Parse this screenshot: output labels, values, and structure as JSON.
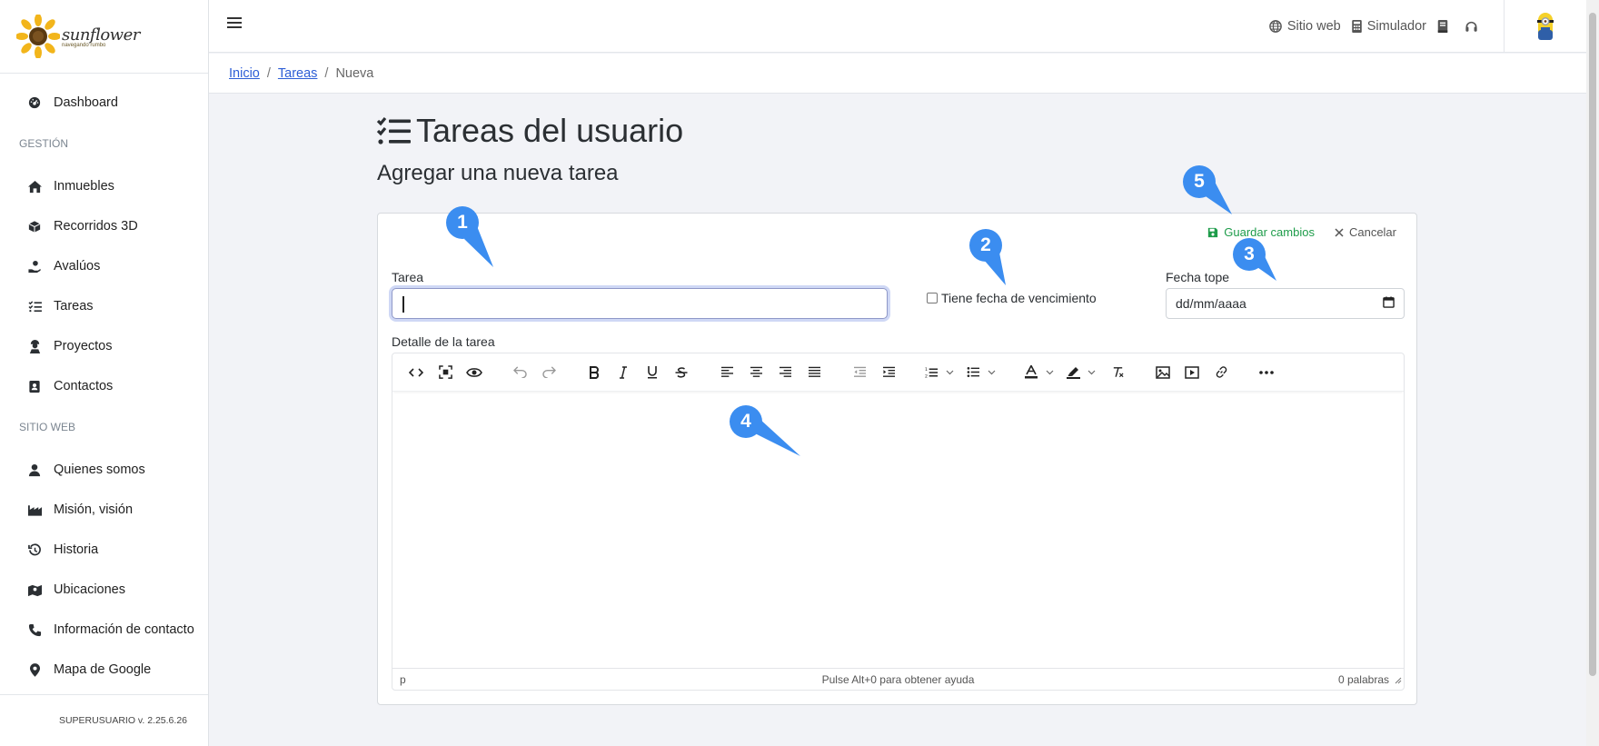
{
  "sidebar": {
    "logo_word": "sunflower",
    "logo_sub": "navegando rumbo",
    "items_top": [
      {
        "label": "Dashboard",
        "icon": "dashboard-icon"
      }
    ],
    "section_gestion": "GESTIÓN",
    "items_gestion": [
      {
        "label": "Inmuebles",
        "icon": "home-icon"
      },
      {
        "label": "Recorridos 3D",
        "icon": "cube-icon"
      },
      {
        "label": "Avalúos",
        "icon": "hand-money-icon"
      },
      {
        "label": "Tareas",
        "icon": "tasks-icon"
      },
      {
        "label": "Proyectos",
        "icon": "worker-icon"
      },
      {
        "label": "Contactos",
        "icon": "address-book-icon"
      }
    ],
    "section_web": "SITIO WEB",
    "items_web": [
      {
        "label": "Quienes somos",
        "icon": "user-icon"
      },
      {
        "label": "Misión, visión",
        "icon": "industry-icon"
      },
      {
        "label": "Historia",
        "icon": "history-icon"
      },
      {
        "label": "Ubicaciones",
        "icon": "map-icon"
      },
      {
        "label": "Información de contacto",
        "icon": "phone-icon"
      },
      {
        "label": "Mapa de Google",
        "icon": "pin-icon"
      }
    ],
    "footer": "SUPERUSUARIO v. 2.25.6.26"
  },
  "topbar": {
    "links": [
      {
        "label": "Sitio web",
        "icon": "globe-icon"
      },
      {
        "label": "Simulador",
        "icon": "calculator-icon"
      }
    ]
  },
  "breadcrumb": {
    "inicio": "Inicio",
    "tareas": "Tareas",
    "current": "Nueva"
  },
  "page": {
    "title": "Tareas del usuario",
    "subtitle": "Agregar una nueva tarea"
  },
  "form": {
    "save_label": "Guardar cambios",
    "cancel_label": "Cancelar",
    "tarea_label": "Tarea",
    "tarea_value": "",
    "has_due_label": "Tiene fecha de vencimiento",
    "has_due_checked": false,
    "due_label": "Fecha tope",
    "due_placeholder": "dd/mm/aaaa",
    "detail_label": "Detalle de la tarea"
  },
  "editor": {
    "status_path": "p",
    "status_help": "Pulse Alt+0 para obtener ayuda",
    "status_words": "0 palabras"
  },
  "callouts": [
    "1",
    "2",
    "3",
    "4",
    "5"
  ],
  "colors": {
    "accent": "#3b8df0",
    "save_green": "#1e9c4a",
    "link_blue": "#2d5ed6",
    "page_bg": "#f2f3f7"
  }
}
